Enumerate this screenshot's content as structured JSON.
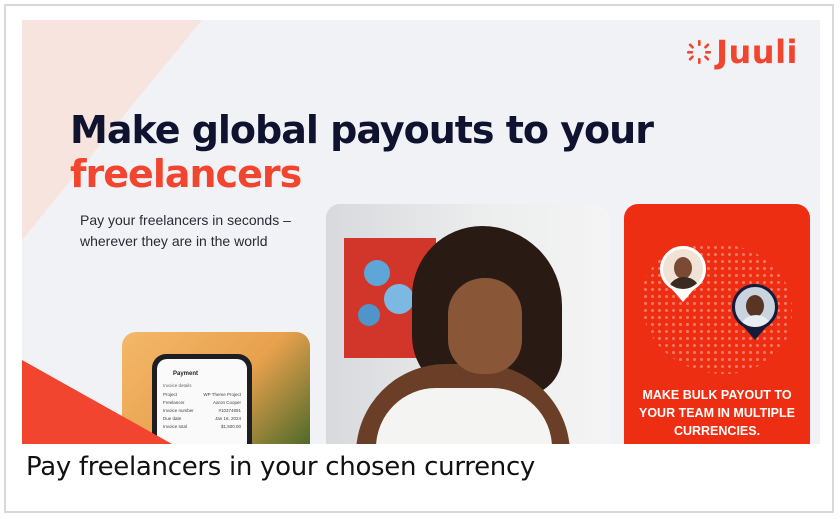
{
  "banner": {
    "logo_text": "Juuli",
    "headline_line1": "Make global payouts to your",
    "headline_accent": "freelancers",
    "subtext": "Pay your freelancers in seconds – wherever they are in the world",
    "phone": {
      "title": "Payment",
      "section": "Invoice details",
      "rows": [
        {
          "label": "Project",
          "value": "WP Theme Project"
        },
        {
          "label": "Freelancer",
          "value": "Aaron Cooper"
        },
        {
          "label": "Invoice number",
          "value": "#10374891"
        },
        {
          "label": "Due date",
          "value": "Jan 16, 2024"
        },
        {
          "label": "Invoice total",
          "value": "$1,500.00"
        }
      ]
    },
    "promo_text": "MAKE BULK PAYOUT TO YOUR TEAM IN MULTIPLE CURRENCIES."
  },
  "caption": "Pay freelancers in your chosen currency",
  "colors": {
    "brand": "#f2452f",
    "navy": "#0f1330",
    "promo_bg": "#ee2e12",
    "banner_bg": "#f1f2f6"
  },
  "icons": [
    "juuli-logo-icon",
    "location-pin-icon"
  ]
}
